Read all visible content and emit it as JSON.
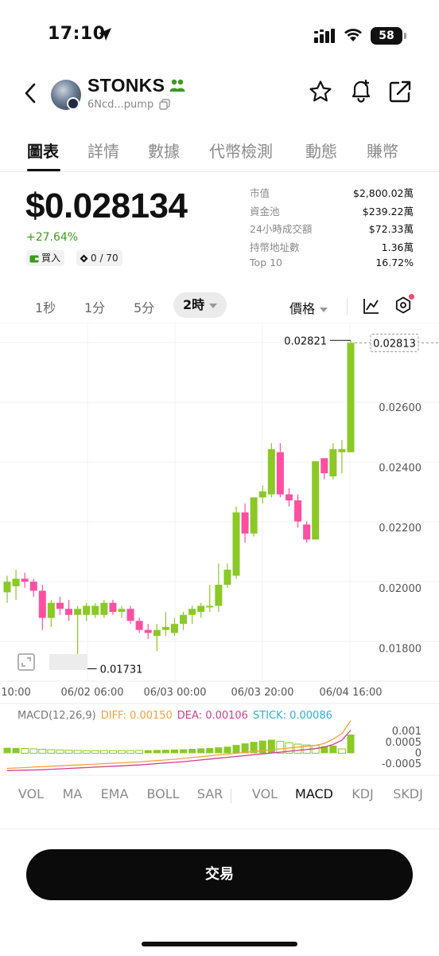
{
  "status_bar": {
    "time": "17:10",
    "battery": "58"
  },
  "header": {
    "token_name": "STONKS",
    "address": "6Ncd...pump"
  },
  "tabs": [
    "圖表",
    "詳情",
    "數據",
    "代幣檢測",
    "動態",
    "賺幣"
  ],
  "price": {
    "value": "$0.028134",
    "change": "+27.64%",
    "buy_label": "買入",
    "holders_ratio": "0 / 70"
  },
  "stats": [
    {
      "label": "市值",
      "value": "$2,800.02萬"
    },
    {
      "label": "資金池",
      "value": "$239.22萬"
    },
    {
      "label": "24小時成交額",
      "value": "$72.33萬"
    },
    {
      "label": "持幣地址數",
      "value": "1.36萬"
    },
    {
      "label": "Top 10",
      "value": "16.72%"
    }
  ],
  "intervals": [
    "1秒",
    "1分",
    "5分",
    "2時"
  ],
  "active_interval": "2時",
  "price_mode": "價格",
  "colors": {
    "up": "#8ac926",
    "down": "#ff4fa0",
    "accent": "#3c9a1e",
    "diff": "#f2a33a",
    "dea": "#cf3f8f",
    "stick": "#2bb0d8"
  },
  "chart_data": {
    "type": "candlestick",
    "y_ticks": [
      "0.02600",
      "0.02400",
      "0.02200",
      "0.02000",
      "0.01800"
    ],
    "y_tick_values": [
      0.026,
      0.024,
      0.022,
      0.02,
      0.018
    ],
    "x_ticks": [
      "10:00",
      "06/02 06:00",
      "06/03 00:00",
      "06/03 20:00",
      "06/04 16:00"
    ],
    "ylim": [
      0.0169,
      0.0288
    ],
    "high_label": "0.02821",
    "low_label": "0.01731",
    "current_price_label": "0.02813",
    "candles": [
      {
        "o": 0.01985,
        "h": 0.0204,
        "l": 0.0195,
        "c": 0.0202
      },
      {
        "o": 0.02005,
        "h": 0.0206,
        "l": 0.0196,
        "c": 0.0203
      },
      {
        "o": 0.0203,
        "h": 0.0205,
        "l": 0.02,
        "c": 0.0202
      },
      {
        "o": 0.0202,
        "h": 0.0203,
        "l": 0.0197,
        "c": 0.0199
      },
      {
        "o": 0.0199,
        "h": 0.0201,
        "l": 0.0186,
        "c": 0.019
      },
      {
        "o": 0.019,
        "h": 0.0196,
        "l": 0.0187,
        "c": 0.0195
      },
      {
        "o": 0.0195,
        "h": 0.0197,
        "l": 0.0191,
        "c": 0.0193
      },
      {
        "o": 0.0193,
        "h": 0.0196,
        "l": 0.0189,
        "c": 0.0191
      },
      {
        "o": 0.0191,
        "h": 0.0194,
        "l": 0.01731,
        "c": 0.0193
      },
      {
        "o": 0.0191,
        "h": 0.0195,
        "l": 0.0189,
        "c": 0.0194
      },
      {
        "o": 0.0191,
        "h": 0.0195,
        "l": 0.019,
        "c": 0.0194
      },
      {
        "o": 0.0191,
        "h": 0.0196,
        "l": 0.019,
        "c": 0.0195
      },
      {
        "o": 0.0195,
        "h": 0.0196,
        "l": 0.0191,
        "c": 0.0192
      },
      {
        "o": 0.0192,
        "h": 0.0194,
        "l": 0.019,
        "c": 0.0193
      },
      {
        "o": 0.0193,
        "h": 0.0194,
        "l": 0.0188,
        "c": 0.0189
      },
      {
        "o": 0.0189,
        "h": 0.019,
        "l": 0.0185,
        "c": 0.0186
      },
      {
        "o": 0.0186,
        "h": 0.0188,
        "l": 0.0183,
        "c": 0.0185
      },
      {
        "o": 0.0184,
        "h": 0.0188,
        "l": 0.0179,
        "c": 0.0186
      },
      {
        "o": 0.0186,
        "h": 0.0192,
        "l": 0.0184,
        "c": 0.0187
      },
      {
        "o": 0.0185,
        "h": 0.019,
        "l": 0.0184,
        "c": 0.0188
      },
      {
        "o": 0.0188,
        "h": 0.0192,
        "l": 0.0186,
        "c": 0.0191
      },
      {
        "o": 0.0191,
        "h": 0.0194,
        "l": 0.0188,
        "c": 0.0193
      },
      {
        "o": 0.0192,
        "h": 0.0195,
        "l": 0.019,
        "c": 0.0194
      },
      {
        "o": 0.0194,
        "h": 0.0201,
        "l": 0.0192,
        "c": 0.0194
      },
      {
        "o": 0.0194,
        "h": 0.0208,
        "l": 0.0192,
        "c": 0.0201
      },
      {
        "o": 0.0201,
        "h": 0.0208,
        "l": 0.02,
        "c": 0.0206
      },
      {
        "o": 0.0204,
        "h": 0.0227,
        "l": 0.0203,
        "c": 0.0225
      },
      {
        "o": 0.0225,
        "h": 0.0228,
        "l": 0.0215,
        "c": 0.0218
      },
      {
        "o": 0.0218,
        "h": 0.023,
        "l": 0.0217,
        "c": 0.023
      },
      {
        "o": 0.023,
        "h": 0.0234,
        "l": 0.0228,
        "c": 0.0232
      },
      {
        "o": 0.0231,
        "h": 0.0248,
        "l": 0.023,
        "c": 0.0246
      },
      {
        "o": 0.0245,
        "h": 0.0248,
        "l": 0.023,
        "c": 0.0231
      },
      {
        "o": 0.0231,
        "h": 0.0233,
        "l": 0.0227,
        "c": 0.0229
      },
      {
        "o": 0.0229,
        "h": 0.0231,
        "l": 0.022,
        "c": 0.0222
      },
      {
        "o": 0.0221,
        "h": 0.0222,
        "l": 0.0215,
        "c": 0.0216
      },
      {
        "o": 0.0216,
        "h": 0.0242,
        "l": 0.0216,
        "c": 0.0242
      },
      {
        "o": 0.0243,
        "h": 0.0243,
        "l": 0.0236,
        "c": 0.0238
      },
      {
        "o": 0.0237,
        "h": 0.0248,
        "l": 0.0236,
        "c": 0.0246
      },
      {
        "o": 0.0245,
        "h": 0.0249,
        "l": 0.0238,
        "c": 0.0246
      },
      {
        "o": 0.0245,
        "h": 0.02821,
        "l": 0.0245,
        "c": 0.02813
      }
    ],
    "macd": {
      "label": "MACD(12,26,9)",
      "diff_label": "DIFF: 0.00150",
      "dea_label": "DEA: 0.00106",
      "stick_label": "STICK: 0.00086",
      "y_ticks": [
        "0.001",
        "0.0005",
        "0",
        "-0.0005"
      ],
      "y_tick_values": [
        0.001,
        0.0005,
        0,
        -0.0005
      ],
      "ylim": [
        -0.0009,
        0.0013
      ],
      "stick": [
        0.00025,
        0.00024,
        0.00022,
        0.0002,
        0.00018,
        0.00016,
        0.00015,
        0.00014,
        0.00013,
        0.00012,
        0.00012,
        0.00012,
        0.00012,
        0.00012,
        0.00012,
        0.00013,
        0.00014,
        0.00015,
        0.00016,
        0.00017,
        0.00018,
        0.0002,
        0.00022,
        0.00024,
        0.00027,
        0.0003,
        0.00038,
        0.00045,
        0.00052,
        0.00058,
        0.00062,
        0.00055,
        0.00048,
        0.00042,
        0.00038,
        0.00036,
        0.00032,
        0.00035,
        0.0002,
        0.00086
      ],
      "stick_up": [
        true,
        true,
        false,
        false,
        false,
        false,
        false,
        false,
        false,
        false,
        false,
        false,
        false,
        false,
        false,
        false,
        true,
        true,
        true,
        true,
        true,
        true,
        true,
        true,
        true,
        true,
        true,
        true,
        true,
        true,
        true,
        false,
        false,
        false,
        false,
        false,
        true,
        true,
        false,
        true
      ],
      "diff": [
        -0.0007,
        -0.00068,
        -0.00066,
        -0.00064,
        -0.00062,
        -0.0006,
        -0.00058,
        -0.00056,
        -0.00054,
        -0.00052,
        -0.0005,
        -0.00048,
        -0.00046,
        -0.00044,
        -0.00042,
        -0.0004,
        -0.00037,
        -0.00034,
        -0.00031,
        -0.00028,
        -0.00024,
        -0.0002,
        -0.00016,
        -0.00012,
        -8e-05,
        -4e-05,
        0.0,
        4e-05,
        8e-05,
        0.00012,
        0.00016,
        0.0002,
        0.00024,
        0.00028,
        0.00032,
        0.00036,
        0.00045,
        0.00065,
        0.0009,
        0.0015
      ],
      "dea": [
        -0.0008,
        -0.00079,
        -0.00078,
        -0.00077,
        -0.00076,
        -0.00074,
        -0.00072,
        -0.0007,
        -0.00068,
        -0.00066,
        -0.00064,
        -0.00062,
        -0.0006,
        -0.00058,
        -0.00056,
        -0.00054,
        -0.00051,
        -0.00048,
        -0.00045,
        -0.00042,
        -0.00039,
        -0.00035,
        -0.00031,
        -0.00027,
        -0.00023,
        -0.00019,
        -0.00015,
        -0.00011,
        -7e-05,
        -3e-05,
        1e-05,
        5e-05,
        9e-05,
        0.00013,
        0.00017,
        0.00021,
        0.00028,
        0.0004,
        0.0006,
        0.00106
      ]
    }
  },
  "indicator_tabs": [
    "VOL",
    "MA",
    "EMA",
    "BOLL",
    "SAR",
    "VOL",
    "MACD",
    "KDJ",
    "SKDJ"
  ],
  "active_indicator": "MACD",
  "trade_label": "交易"
}
